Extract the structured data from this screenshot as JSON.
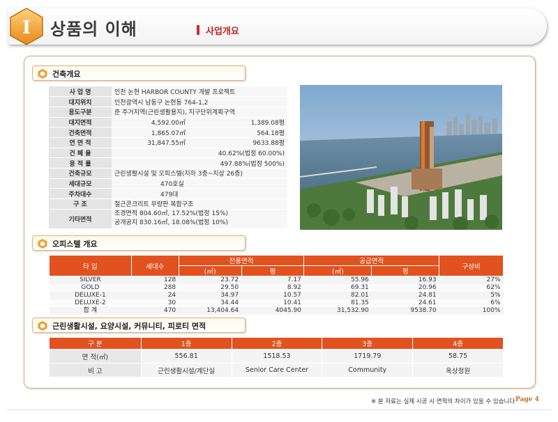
{
  "header": {
    "numeral": "I",
    "title": "상품의 이해",
    "subtitle": "사업개요"
  },
  "overview": {
    "section_label": "건축개요",
    "rows": [
      {
        "label": "사 업 명",
        "value": "인천 논현 HARBOR COUNTY 개발 프로젝트"
      },
      {
        "label": "대지위치",
        "value": "인천광역시 남동구 논현동 764-1,2"
      },
      {
        "label": "용도구분",
        "value": "준 주거지역(근린생활용지), 지구단위계획구역"
      },
      {
        "label": "대지면적",
        "value": "4,592.00㎡",
        "value2": "1,389.08평"
      },
      {
        "label": "건축면적",
        "value": "1,865.07㎡",
        "value2": "564.18평"
      },
      {
        "label": "연 면 적",
        "value": "31,847.55㎡",
        "value2": "9633.88평"
      },
      {
        "label": "건 폐 율",
        "value": "40.62%(법정 60.00%)"
      },
      {
        "label": "용 적 률",
        "value": "497.88%(법정 500%)"
      },
      {
        "label": "건축규모",
        "value": "근린생활시설 및 오피스텔(지하 3층~지상 26층)"
      },
      {
        "label": "세대규모",
        "value": "470호실"
      },
      {
        "label": "주차대수",
        "value": "479대"
      },
      {
        "label": "구 조",
        "value": "철근콘크리트 무량판 복합구조"
      },
      {
        "label": "기타면적",
        "value": "조경면적 804.60㎡, 17.52%(법정 15%)",
        "value2": "공개공지 830.16㎡, 18.08%(법정 10%)"
      }
    ]
  },
  "officetel": {
    "section_label": "오피스텔 개요",
    "headers": {
      "type": "타 입",
      "units": "세대수",
      "exclusive": "전용면적",
      "supply": "공급면적",
      "sqm": "(㎡)",
      "pyeong": "평",
      "ratio": "구성비"
    },
    "rows": [
      {
        "type": "SILVER",
        "units": "128",
        "ex_sqm": "23.72",
        "ex_py": "7.17",
        "sup_sqm": "55.96",
        "sup_py": "16.93",
        "ratio": "27%"
      },
      {
        "type": "GOLD",
        "units": "288",
        "ex_sqm": "29.50",
        "ex_py": "8.92",
        "sup_sqm": "69.31",
        "sup_py": "20.96",
        "ratio": "62%"
      },
      {
        "type": "DELUXE-1",
        "units": "24",
        "ex_sqm": "34.97",
        "ex_py": "10.57",
        "sup_sqm": "82.01",
        "sup_py": "24.81",
        "ratio": "5%"
      },
      {
        "type": "DELUXE-2",
        "units": "30",
        "ex_sqm": "34.44",
        "ex_py": "10.41",
        "sup_sqm": "81.35",
        "sup_py": "24.61",
        "ratio": "6%"
      },
      {
        "type": "합 계",
        "units": "470",
        "ex_sqm": "13,404.64",
        "ex_py": "4045.90",
        "sup_sqm": "31,532.90",
        "sup_py": "9538.70",
        "ratio": "100%"
      }
    ]
  },
  "facility": {
    "section_label": "근린생활시설, 요양시설, 커뮤니티, 피로티 면적",
    "headers": [
      "구 분",
      "1층",
      "2층",
      "3층",
      "4층"
    ],
    "area_row": {
      "label": "면 적(㎡)",
      "values": [
        "556.81",
        "1518.53",
        "1719.79",
        "58.75"
      ]
    },
    "note_row": {
      "label": "비 고",
      "values": [
        "근린생활시설/계단실",
        "Senior Care Center",
        "Community",
        "옥상정원"
      ]
    }
  },
  "footer": {
    "note": "※ 본 자료는 실제 시공 시 면적의 차이가 있을 수 있습니다",
    "page": "Page 4"
  },
  "colors": {
    "accent": "#e1521f",
    "badge": "#f5a623",
    "title_red": "#c0262b"
  }
}
